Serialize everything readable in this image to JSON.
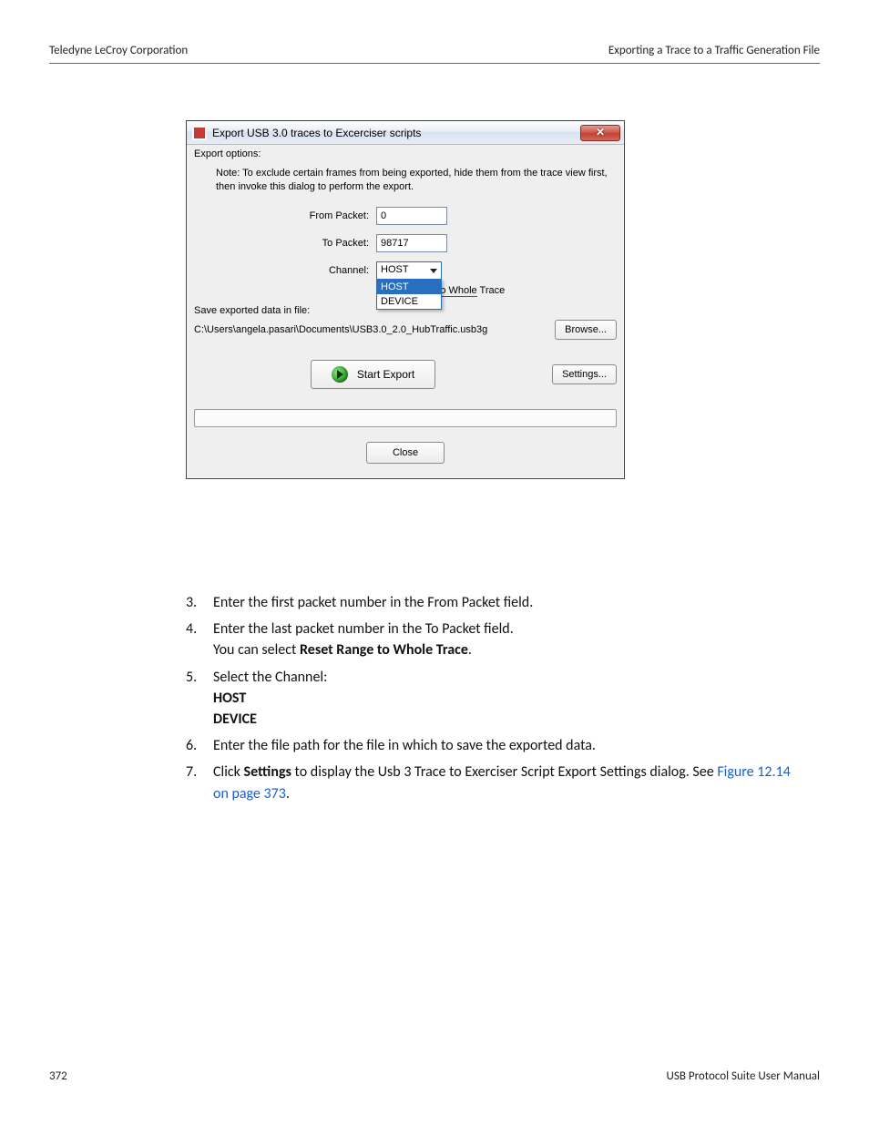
{
  "header": {
    "left": "Teledyne LeCroy Corporation",
    "right": "Exporting a Trace to a Traffic Generation File"
  },
  "footer": {
    "left": "372",
    "right": "USB Protocol Suite User Manual"
  },
  "dialog": {
    "title": "Export USB 3.0 traces to Excerciser scripts",
    "close_glyph": "✕",
    "export_options_label": "Export options:",
    "note": "Note: To exclude certain frames from being exported, hide them from the trace view first, then invoke this dialog to perform the export.",
    "from_packet_label": "From Packet:",
    "from_packet_value": "0",
    "to_packet_label": "To Packet:",
    "to_packet_value": "98717",
    "channel_label": "Channel:",
    "channel_value": "HOST",
    "channel_options": [
      "HOST",
      "DEVICE"
    ],
    "reset_label": "Reset Range to Whole Trace",
    "reset_prefix": "Reset ",
    "reset_suffix": " Trace",
    "save_label": "Save exported data in file:",
    "file_path": "C:\\Users\\angela.pasari\\Documents\\USB3.0_2.0_HubTraffic.usb3g",
    "browse_label": "Browse...",
    "start_label": "Start Export",
    "settings_label": "Settings...",
    "close_label": "Close"
  },
  "list": {
    "item3_num": "3.",
    "item3": "Enter the first packet number in the From Packet field.",
    "item4_num": "4.",
    "item4a": "Enter the last packet number in the To Packet field.",
    "item4b_pre": "You can select ",
    "item4b_bold": "Reset Range to Whole Trace",
    "item4b_post": ".",
    "item5_num": "5.",
    "item5": "Select the Channel:",
    "item5_opt1": "HOST",
    "item5_opt2": "DEVICE",
    "item6_num": "6.",
    "item6": "Enter the file path for the file in which to save the exported data.",
    "item7_num": "7.",
    "item7_pre": "Click ",
    "item7_bold": "Settings",
    "item7_post": " to display the Usb 3 Trace to Exerciser Script Export Settings dialog. See ",
    "item7_link": "Figure 12.14 on page 373",
    "item7_end": "."
  }
}
